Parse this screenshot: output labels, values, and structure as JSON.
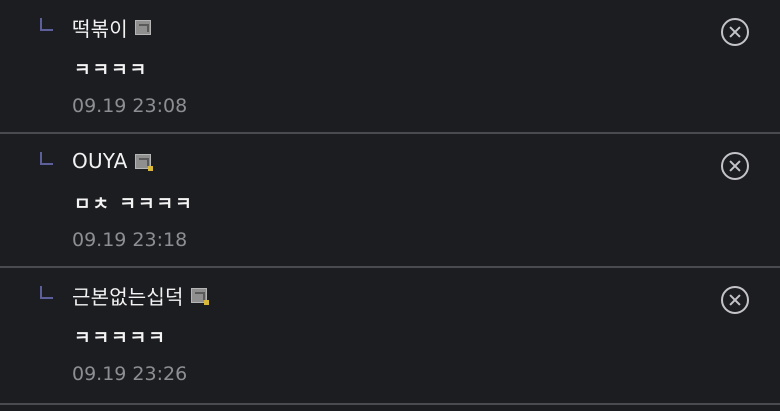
{
  "replies": [
    {
      "nickname": "떡볶이",
      "comment": "ㅋㅋㅋㅋ",
      "time": "09.19 23:08",
      "badge_icon": "level-badge-icon"
    },
    {
      "nickname": "OUYA",
      "comment": "ㅁㅊ ㅋㅋㅋㅋ",
      "time": "09.19 23:18",
      "badge_icon": "level-badge-icon"
    },
    {
      "nickname": "근본없는십덕",
      "comment": "ㅋㅋㅋㅋㅋ",
      "time": "09.19 23:26",
      "badge_icon": "level-badge-icon"
    }
  ],
  "colors": {
    "background": "#1c1d21",
    "divider": "#4a4b50",
    "reply_marker": "#5c5f9a",
    "timestamp": "#8d8e93",
    "badge_dot": "#d8b83a"
  },
  "icons": {
    "reply": "reply-arrow-icon",
    "delete": "circle-close-icon"
  }
}
